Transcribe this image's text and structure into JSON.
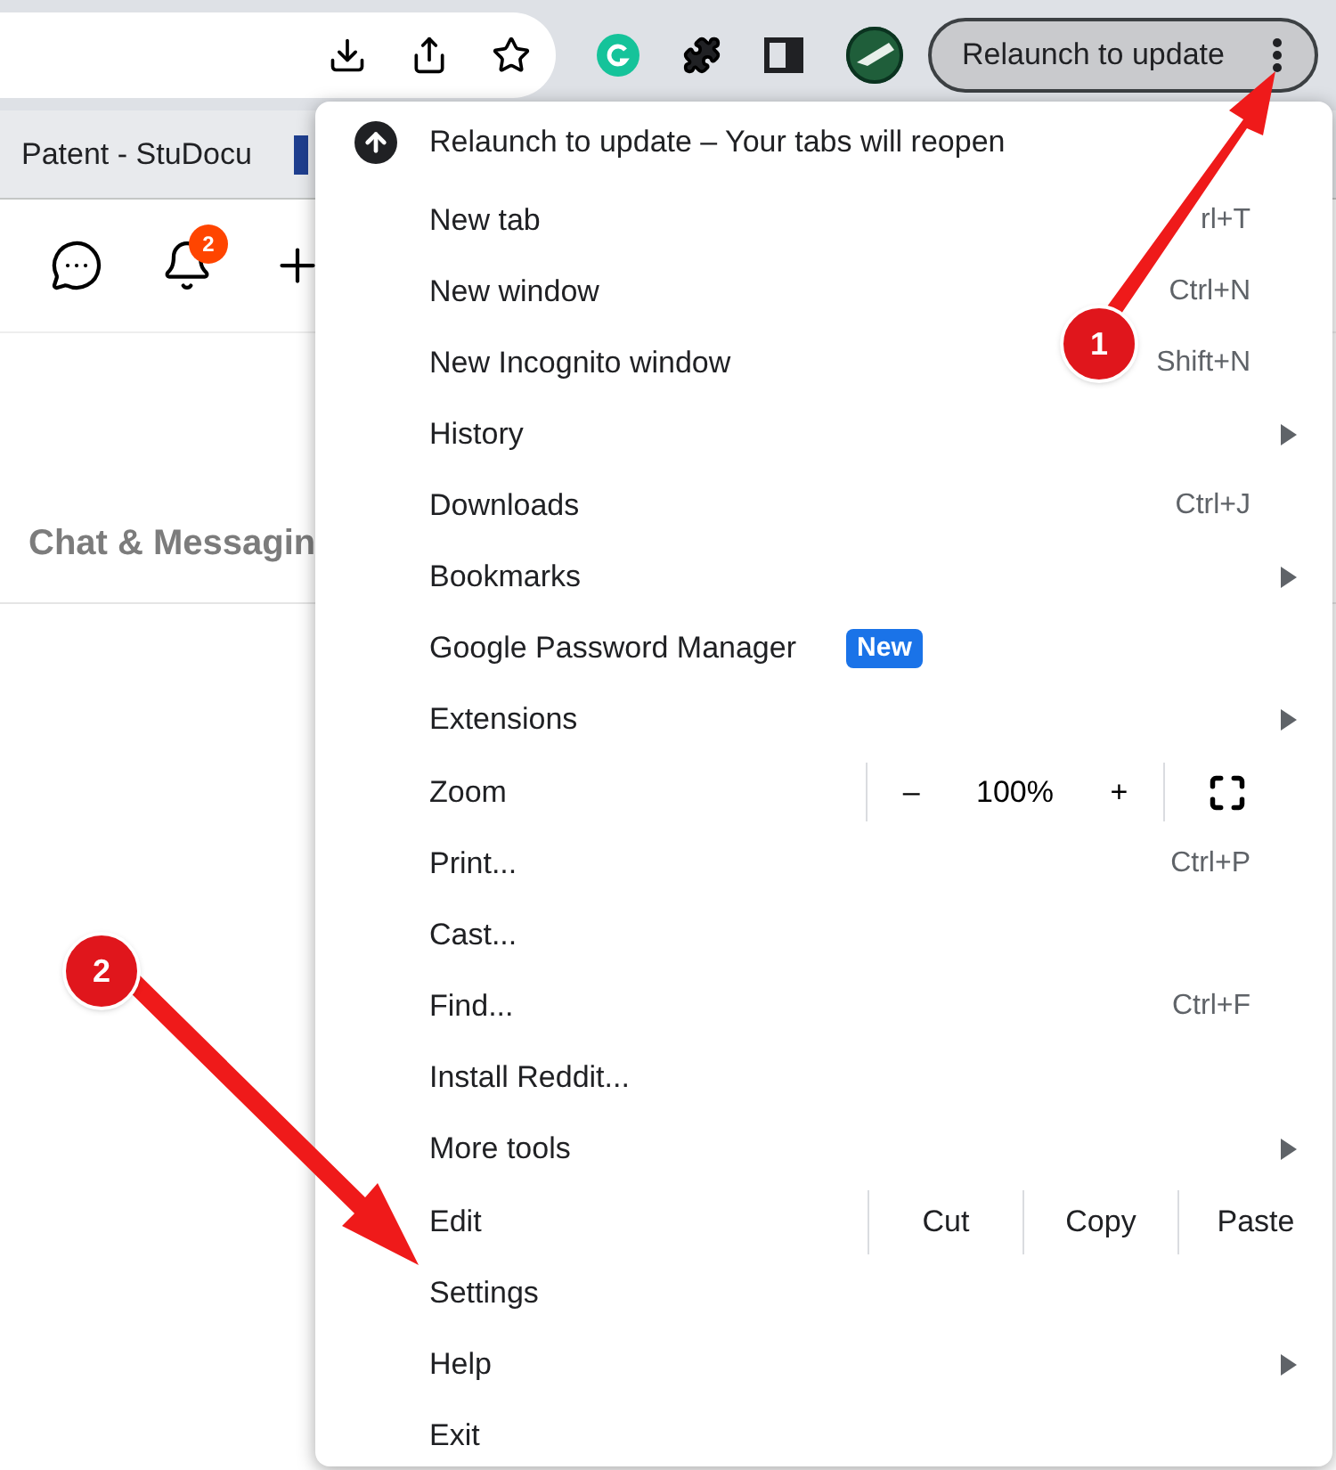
{
  "toolbar": {
    "update_button": "Relaunch to update"
  },
  "bookmarks_bar": {
    "items": [
      "Patent - StuDocu"
    ]
  },
  "page": {
    "notification_count": "2",
    "section_title": "Chat & Messagin"
  },
  "menu": {
    "header": "Relaunch to update – Your tabs will reopen",
    "items": [
      {
        "kind": "item",
        "label": "New tab",
        "shortcut": "rl+T",
        "submenu": false
      },
      {
        "kind": "item",
        "label": "New window",
        "shortcut": "Ctrl+N",
        "submenu": false
      },
      {
        "kind": "item",
        "label": "New Incognito window",
        "shortcut": "Shift+N",
        "submenu": false
      },
      {
        "kind": "item",
        "label": "History",
        "submenu": true
      },
      {
        "kind": "item",
        "label": "Downloads",
        "shortcut": "Ctrl+J",
        "submenu": false
      },
      {
        "kind": "item",
        "label": "Bookmarks",
        "submenu": true
      },
      {
        "kind": "item",
        "label": "Google Password Manager",
        "badge": "New",
        "submenu": false
      },
      {
        "kind": "item",
        "label": "Extensions",
        "submenu": true
      },
      {
        "kind": "zoom",
        "label": "Zoom",
        "minus": "–",
        "value": "100%",
        "plus": "+"
      },
      {
        "kind": "item",
        "label": "Print...",
        "shortcut": "Ctrl+P",
        "submenu": false
      },
      {
        "kind": "item",
        "label": "Cast...",
        "submenu": false
      },
      {
        "kind": "item",
        "label": "Find...",
        "shortcut": "Ctrl+F",
        "submenu": false
      },
      {
        "kind": "item",
        "label": "Install Reddit...",
        "submenu": false
      },
      {
        "kind": "item",
        "label": "More tools",
        "submenu": true
      },
      {
        "kind": "edit",
        "label": "Edit",
        "actions": [
          "Cut",
          "Copy",
          "Paste"
        ]
      },
      {
        "kind": "item",
        "label": "Settings",
        "submenu": false
      },
      {
        "kind": "item",
        "label": "Help",
        "submenu": true
      },
      {
        "kind": "item",
        "label": "Exit",
        "submenu": false
      }
    ]
  },
  "annotations": [
    {
      "label": "1"
    },
    {
      "label": "2"
    }
  ]
}
